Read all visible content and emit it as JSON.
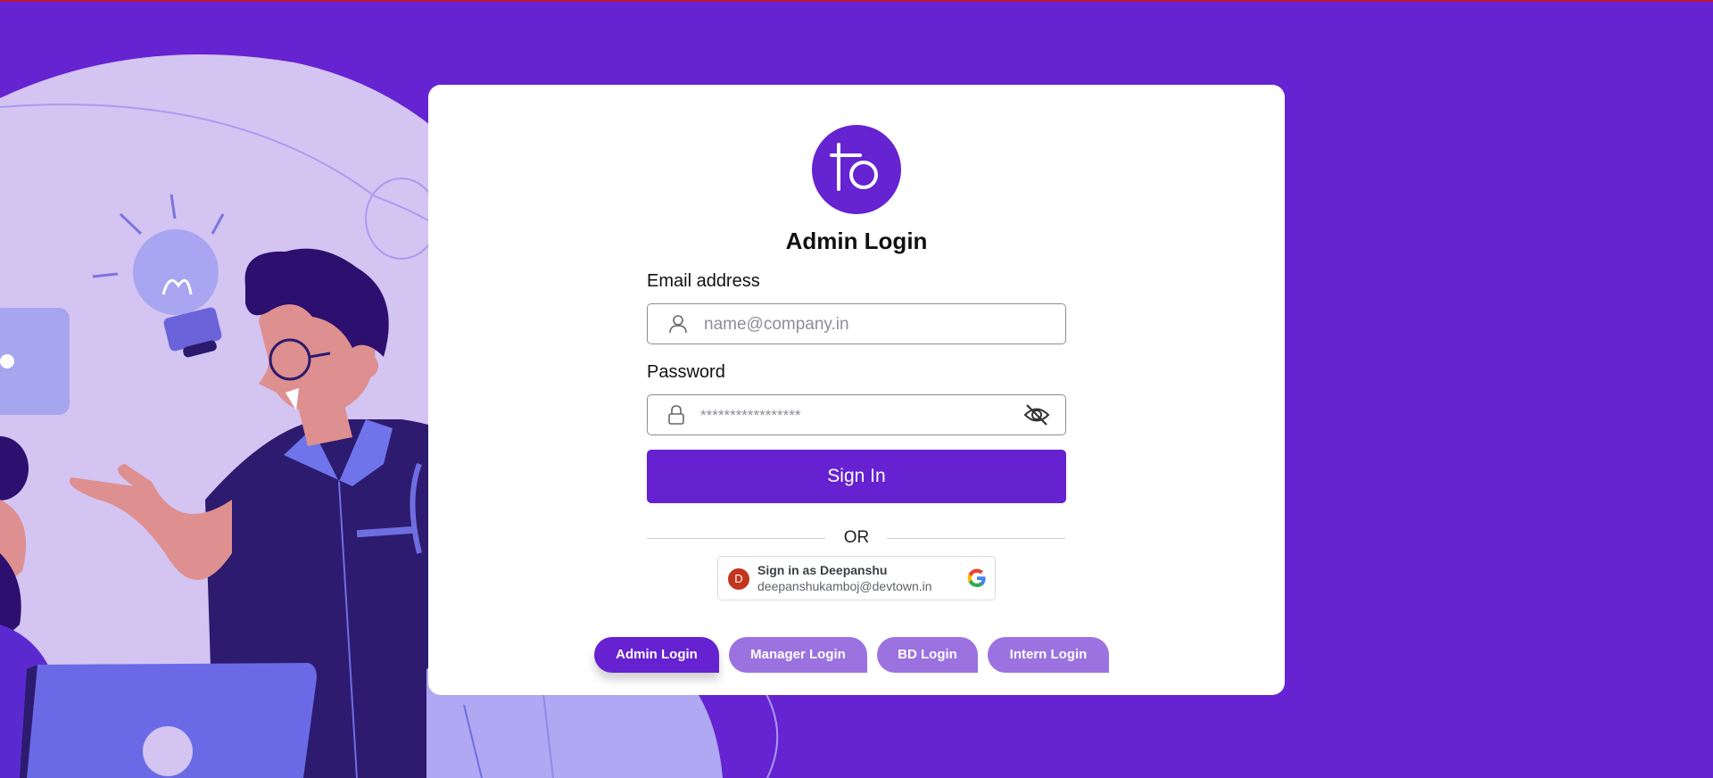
{
  "page": {
    "title": "Admin Login",
    "logo_text": "to"
  },
  "form": {
    "email_label": "Email address",
    "email_placeholder": "name@company.in",
    "password_label": "Password",
    "password_placeholder": "*****************",
    "signin_label": "Sign In",
    "or_label": "OR"
  },
  "google": {
    "avatar_letter": "D",
    "signin_text": "Sign in as Deepanshu",
    "email": "deepanshukamboj@devtown.in"
  },
  "login_tabs": [
    {
      "label": "Admin Login",
      "active": true
    },
    {
      "label": "Manager Login",
      "active": false
    },
    {
      "label": "BD Login",
      "active": false
    },
    {
      "label": "Intern Login",
      "active": false
    }
  ],
  "colors": {
    "primary": "#6623d1",
    "tab_inactive": "#9b72e0",
    "card": "#ffffff"
  }
}
